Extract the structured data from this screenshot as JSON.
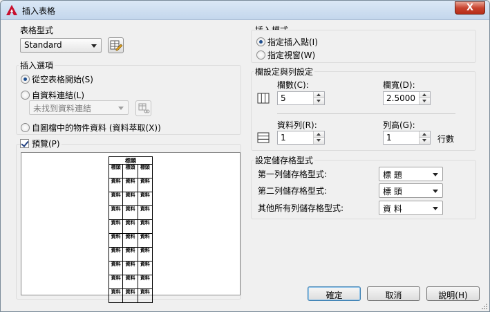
{
  "window": {
    "title": "插入表格",
    "close_label": "X"
  },
  "table_style": {
    "group_title": "表格型式",
    "selected": "Standard",
    "edit_icon": "table-style-edit-icon"
  },
  "insert_options": {
    "group_title": "插入選項",
    "from_empty": "從空表格開始(S)",
    "from_data_link": "自資料連結(L)",
    "data_link_value": "未找到資料連結",
    "from_objects": "自圖檔中的物件資料 (資料萃取(X))",
    "selected": "from_empty"
  },
  "preview": {
    "label": "預覽(P)",
    "checked": true,
    "header_title": "標題",
    "header_cells": [
      "標頭",
      "標頭",
      "標頭"
    ],
    "data_cells": [
      "資料",
      "資料",
      "資料"
    ],
    "data_row_count": 9
  },
  "insert_mode": {
    "group_title": "插入模式",
    "specify_point": "指定插入點(I)",
    "specify_window": "指定視窗(W)",
    "selected": "specify_point"
  },
  "columns_rows": {
    "group_title": "欄設定與列設定",
    "columns_label": "欄數(C):",
    "columns_value": "5",
    "col_width_label": "欄寬(D):",
    "col_width_value": "2.5000",
    "data_rows_label": "資料列(R):",
    "data_rows_value": "1",
    "row_height_label": "列高(G):",
    "row_height_value": "1",
    "row_height_unit": "行數"
  },
  "cell_styles": {
    "group_title": "設定儲存格型式",
    "first_row_label": "第一列儲存格型式:",
    "first_row_value": "標 題",
    "second_row_label": "第二列儲存格型式:",
    "second_row_value": "標 頭",
    "other_rows_label": "其他所有列儲存格型式:",
    "other_rows_value": "資 料"
  },
  "buttons": {
    "ok": "確定",
    "cancel": "取消",
    "help": "說明(H)"
  },
  "colors": {
    "accent": "#3c7fb1",
    "title_bar": "#c3d6ec",
    "close": "#c8432f"
  }
}
